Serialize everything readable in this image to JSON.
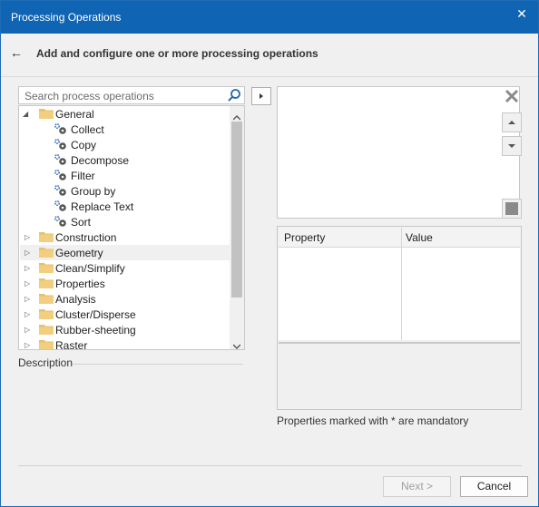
{
  "window": {
    "title": "Processing Operations",
    "close_glyph": "✕"
  },
  "header": {
    "back_glyph": "←",
    "heading": "Add and configure one or more processing operations"
  },
  "search": {
    "placeholder": "Search process operations",
    "icon": "search-icon"
  },
  "tree": {
    "root": {
      "label": "General",
      "expanded": true
    },
    "general_children": [
      "Collect",
      "Copy",
      "Decompose",
      "Filter",
      "Group by",
      "Replace Text",
      "Sort"
    ],
    "categories": [
      "Construction",
      "Geometry",
      "Clean/Simplify",
      "Properties",
      "Analysis",
      "Cluster/Disperse",
      "Rubber-sheeting",
      "Raster"
    ],
    "highlighted": "Geometry"
  },
  "description": {
    "label": "Description"
  },
  "property_grid": {
    "col_property": "Property",
    "col_value": "Value"
  },
  "mandatory_note": "Properties marked with * are mandatory",
  "buttons": {
    "next": "Next >",
    "cancel": "Cancel"
  },
  "colors": {
    "title_bar": "#0f64b3",
    "folder": "#e8c06b",
    "gear": "#3a6fb5"
  }
}
